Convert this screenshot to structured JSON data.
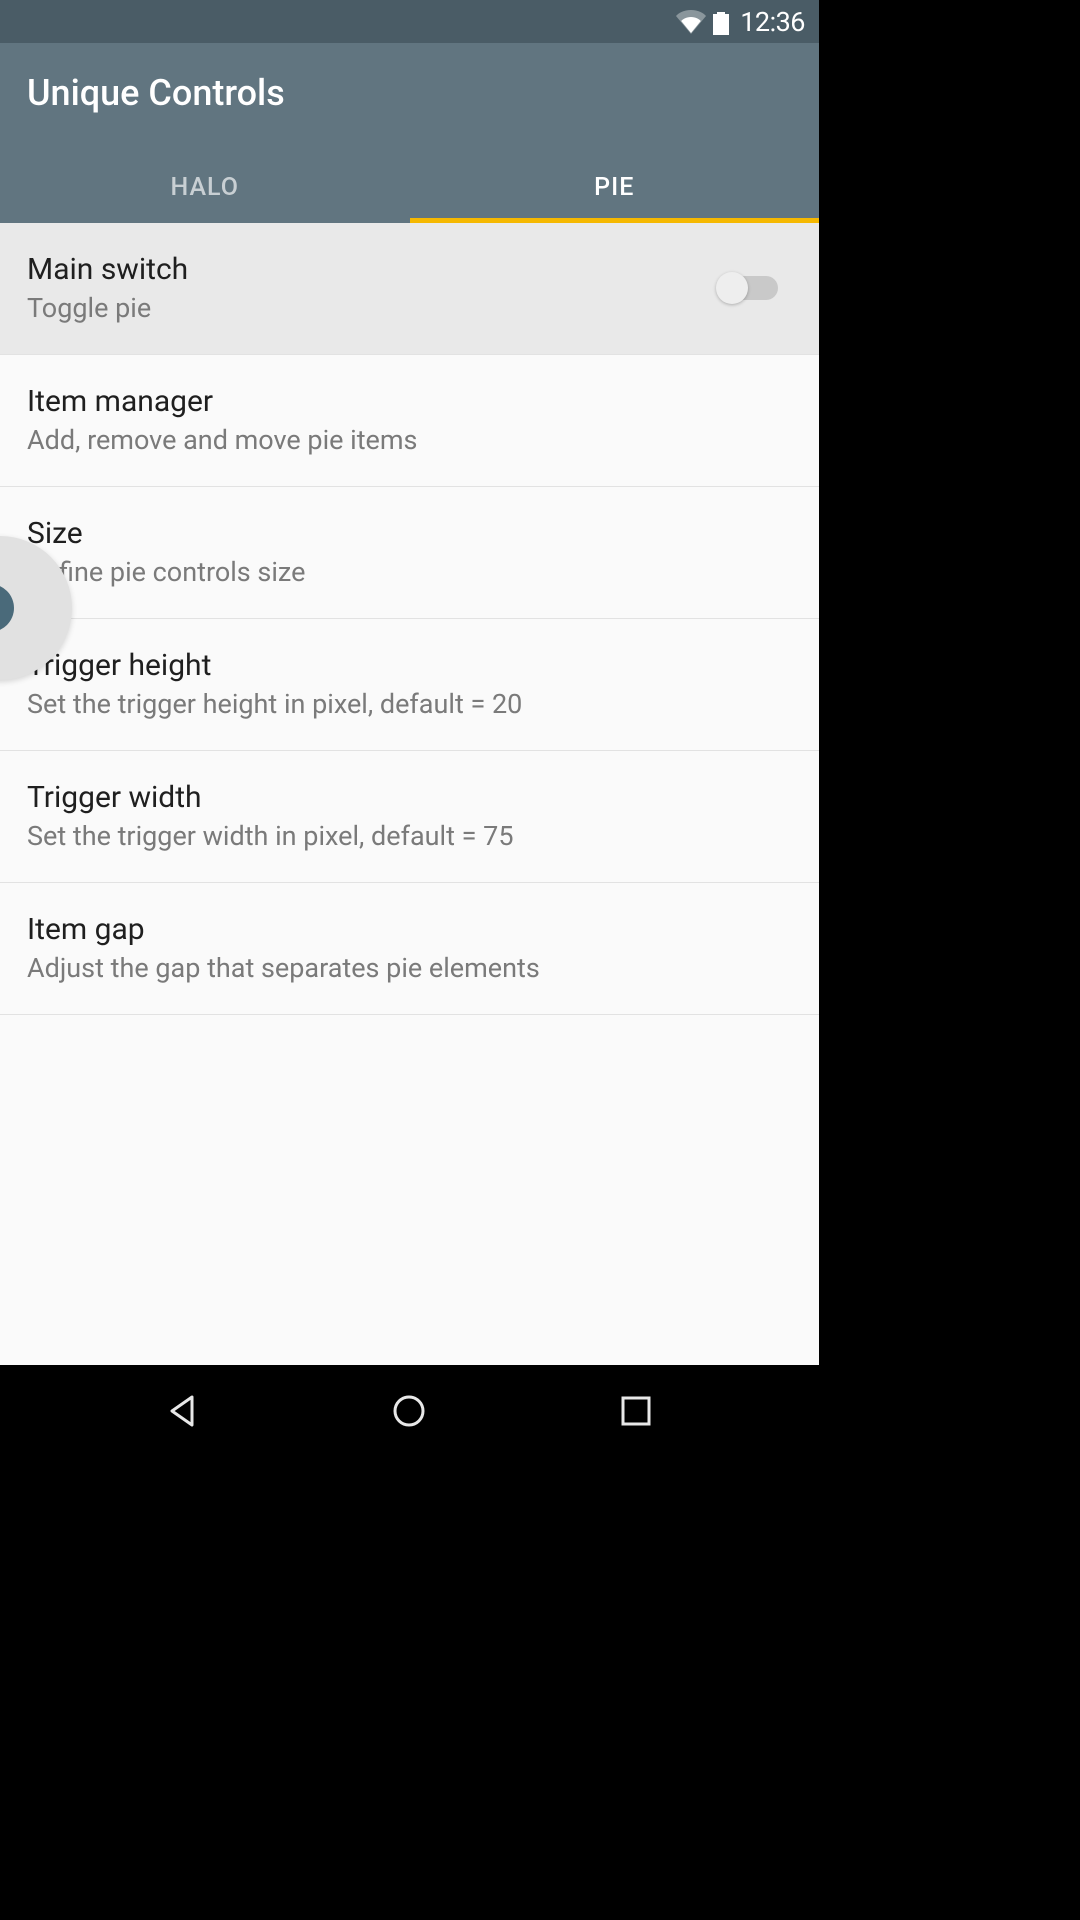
{
  "status": {
    "time": "12:36"
  },
  "header": {
    "title": "Unique Controls"
  },
  "tabs": [
    {
      "label": "HALO",
      "active": false
    },
    {
      "label": "PIE",
      "active": true
    }
  ],
  "settings": [
    {
      "title": "Main switch",
      "subtitle": "Toggle pie",
      "has_switch": true,
      "switch_on": false,
      "highlighted": true
    },
    {
      "title": "Item manager",
      "subtitle": "Add, remove and move pie items"
    },
    {
      "title": "Size",
      "subtitle": "Define pie controls size"
    },
    {
      "title": "Trigger height",
      "subtitle": "Set the trigger height in pixel, default = 20"
    },
    {
      "title": "Trigger width",
      "subtitle": "Set the trigger width in pixel, default = 75"
    },
    {
      "title": "Item gap",
      "subtitle": "Adjust the gap that separates pie elements"
    }
  ]
}
